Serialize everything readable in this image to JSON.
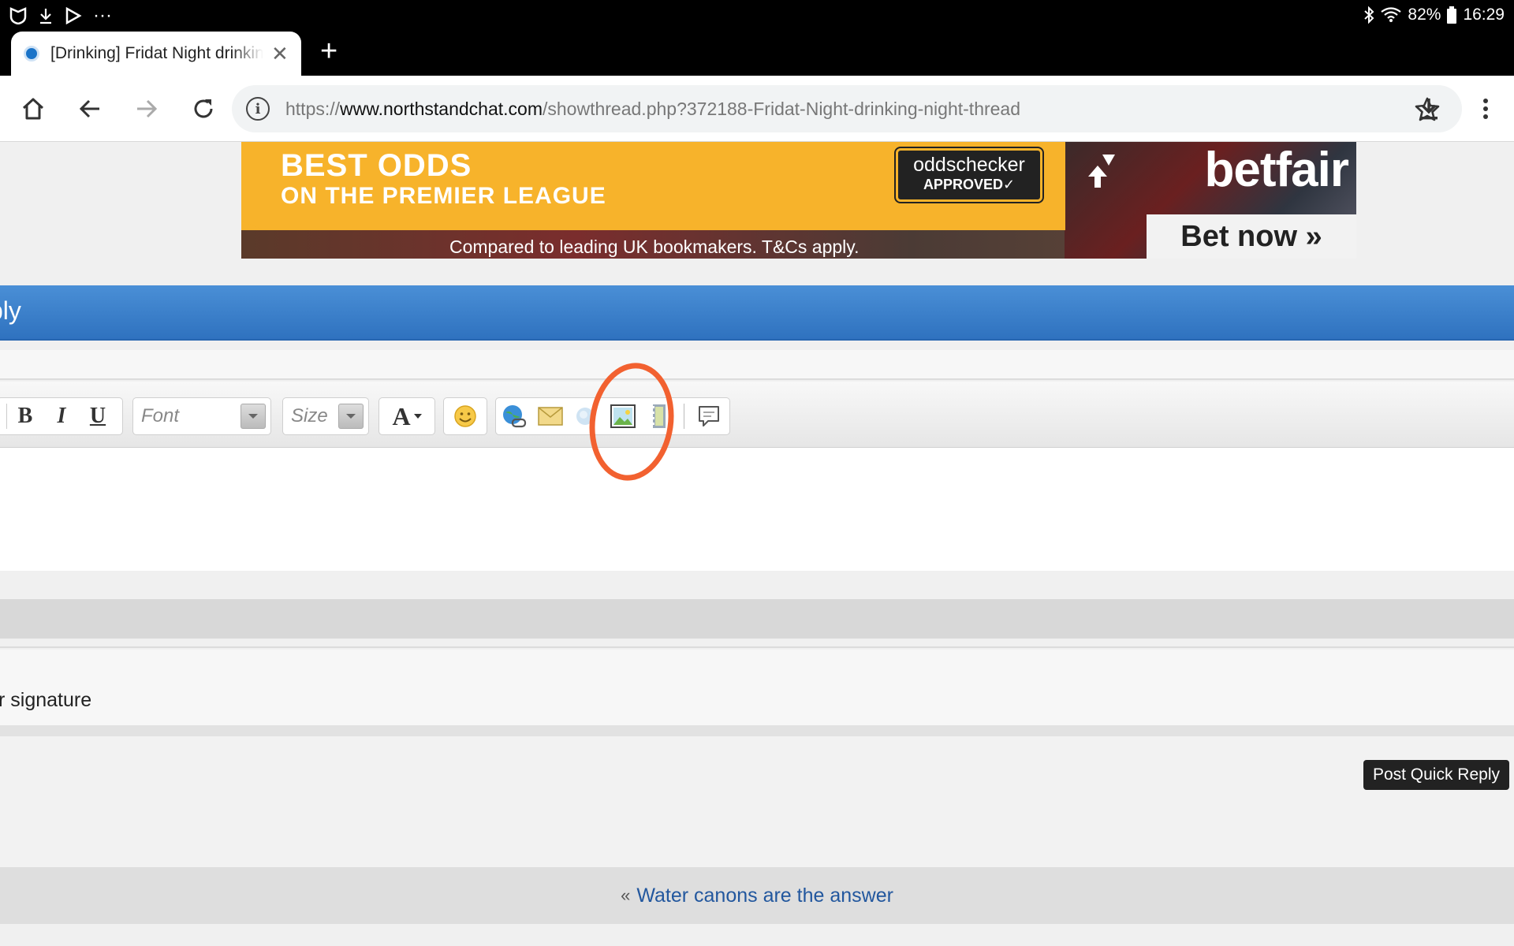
{
  "status_bar": {
    "battery": "82%",
    "time": "16:29",
    "more": "···"
  },
  "tab": {
    "title": "[Drinking] Fridat Night drinking night thread",
    "close": "✕",
    "new_tab": "+"
  },
  "omnibox": {
    "scheme": "https://",
    "host": "www.northstandchat.com",
    "path": "/showthread.php?372188-Fridat-Night-drinking-night-thread",
    "info": "i"
  },
  "banner": {
    "headline": "BEST ODDS",
    "subheadline": "ON THE PREMIER LEAGUE",
    "badge_brand": "oddschecker",
    "badge_approved": "APPROVED✓",
    "brand": "betfair",
    "cta": "Bet now »",
    "terms": "Compared to leading UK bookmakers. T&Cs apply."
  },
  "quick_reply": {
    "title": "ply"
  },
  "editor": {
    "bold": "B",
    "italic": "I",
    "underline": "U",
    "font_placeholder": "Font",
    "size_placeholder": "Size",
    "color_label": "A"
  },
  "signature": {
    "label": "r signature"
  },
  "actions": {
    "post_quick_reply": "Post Quick Reply"
  },
  "navigation": {
    "prev_marker": "«",
    "prev_thread": "Water canons are the answer"
  },
  "colors": {
    "header_blue": "#2f72bf",
    "annotation": "#f26130",
    "link": "#22579e",
    "banner_yellow": "#f7b32b"
  }
}
